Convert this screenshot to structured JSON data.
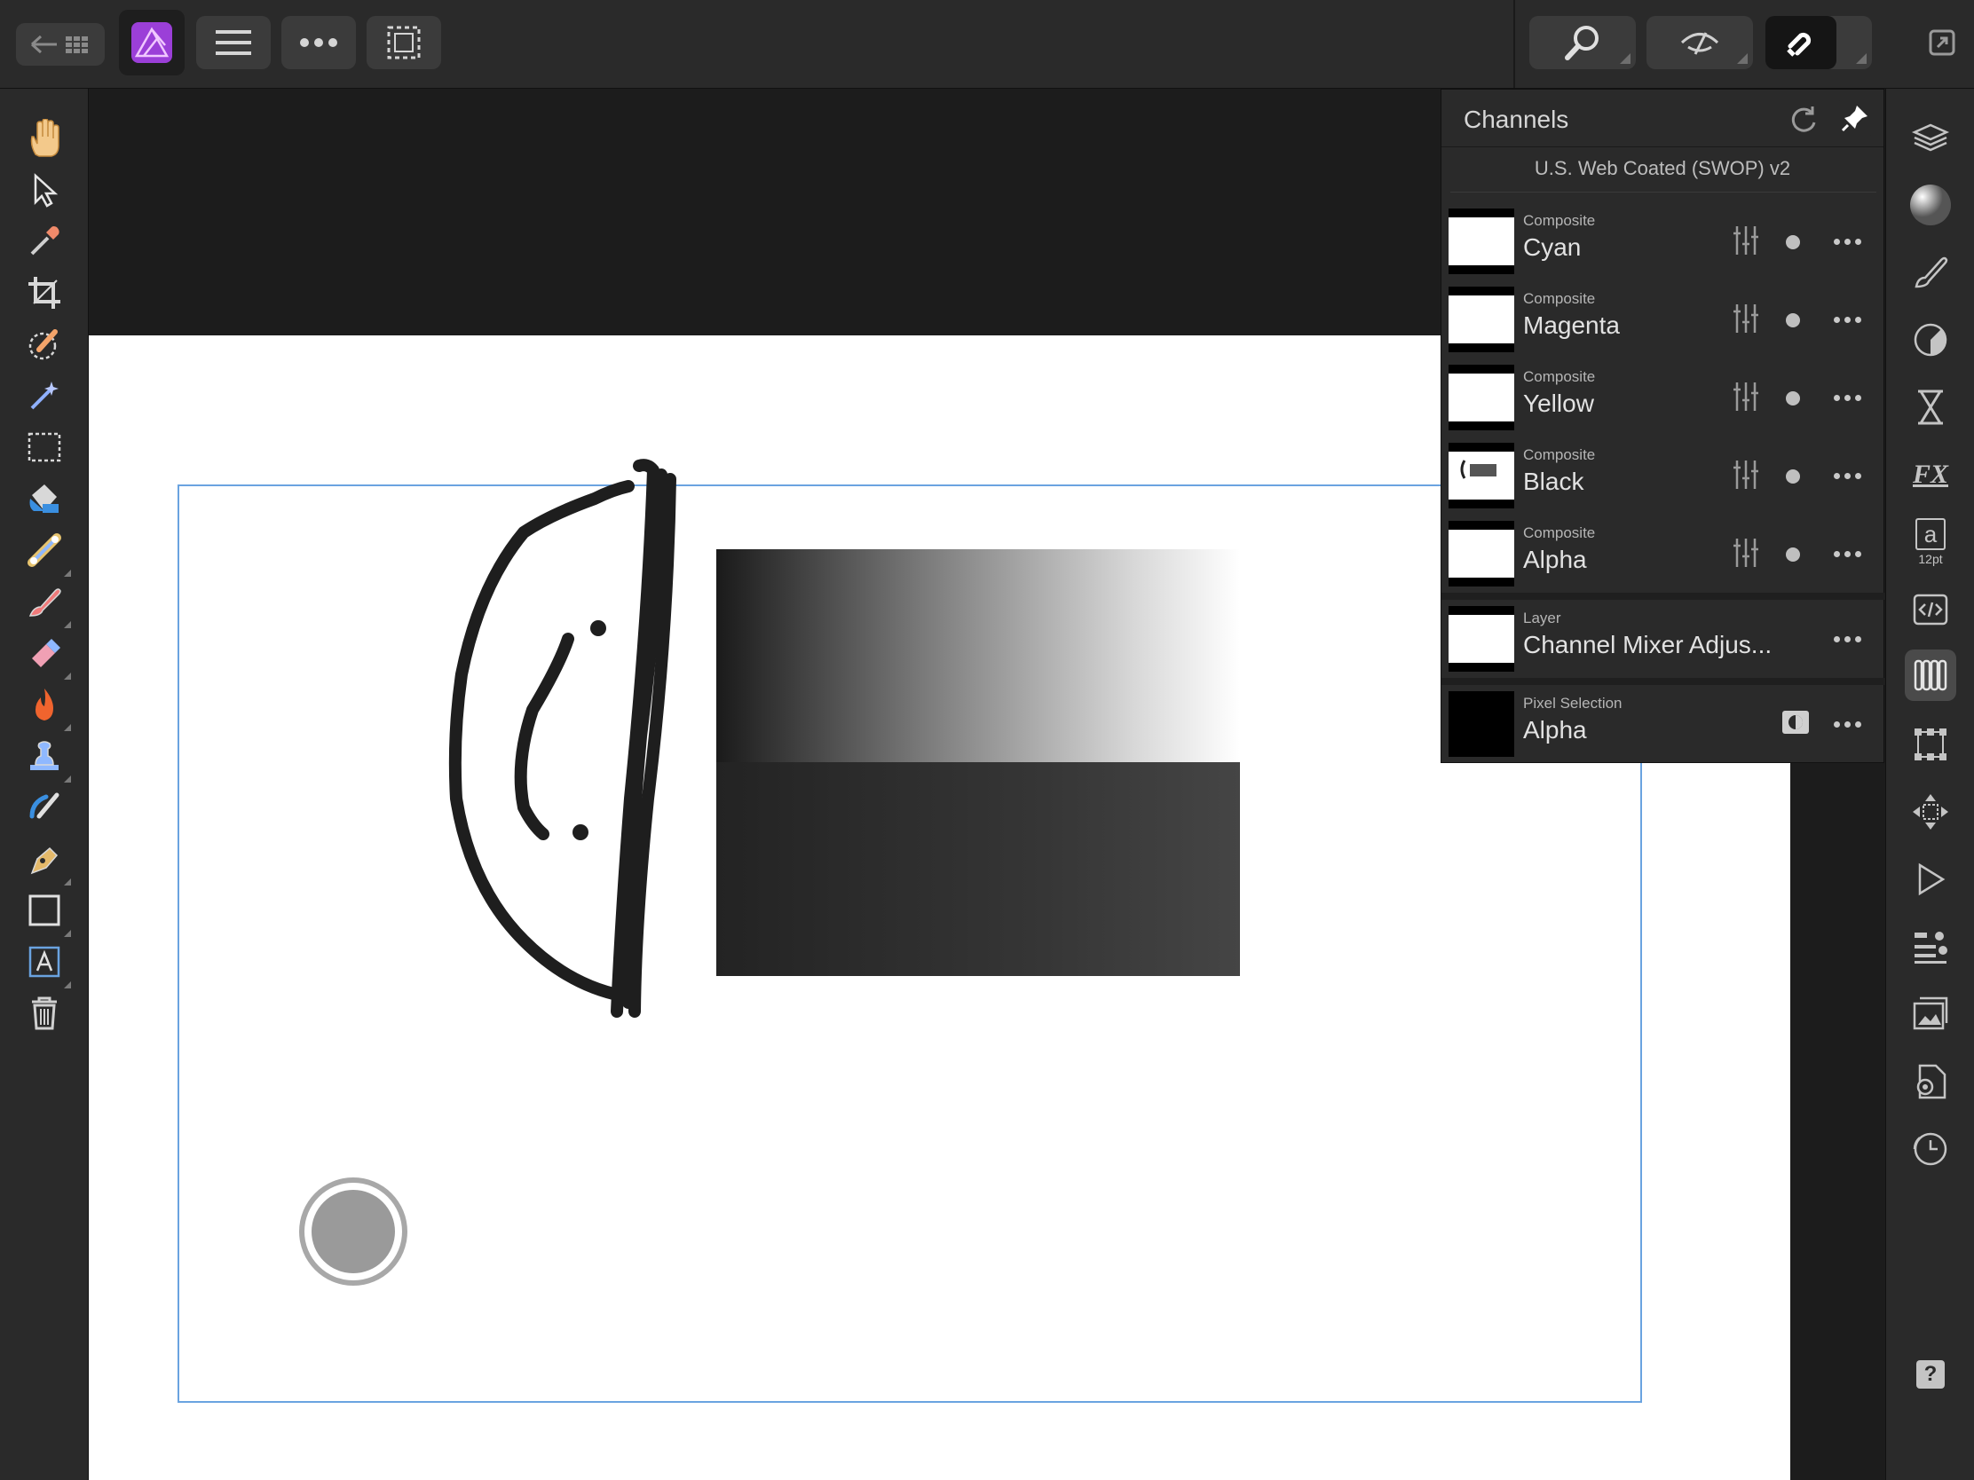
{
  "app": {
    "brand_color": "#9b3fd8",
    "selection_color": "#6aa3e0"
  },
  "topbar": {
    "left_buttons": [
      "back-to-gallery-icon",
      "app-logo-icon",
      "menu-icon",
      "more-icon",
      "selection-icon"
    ],
    "right_buttons": [
      "zoom-icon",
      "view-mode-icon",
      "snapping-icon",
      "fullscreen-icon"
    ]
  },
  "left_tools": [
    "hand-icon",
    "move-icon",
    "color-picker-icon",
    "crop-icon",
    "selection-brush-icon",
    "flood-select-icon",
    "marquee-icon",
    "fill-icon",
    "gradient-icon",
    "paint-brush-icon",
    "eraser-icon",
    "burn-icon",
    "clone-icon",
    "smudge-icon",
    "pen-icon",
    "rectangle-icon",
    "artistic-text-icon",
    "delete-icon"
  ],
  "studio_tools": [
    "layers-icon",
    "color-icon",
    "brushes-icon",
    "adjustments-icon",
    "transparency-icon",
    "fx-icon",
    "character-icon",
    "macro-icon",
    "channels-icon",
    "transform-icon",
    "navigator-icon",
    "stock-icon",
    "styles-icon",
    "history-icon",
    "document-settings-icon",
    "time-icon",
    "help-icon"
  ],
  "studio_labels": {
    "character_size": "12pt",
    "character_glyph": "a",
    "fx_label": "FX",
    "help_label": "?"
  },
  "channels": {
    "title": "Channels",
    "profile": "U.S. Web Coated (SWOP) v2",
    "composite": [
      {
        "kind": "Composite",
        "name": "Cyan"
      },
      {
        "kind": "Composite",
        "name": "Magenta"
      },
      {
        "kind": "Composite",
        "name": "Yellow"
      },
      {
        "kind": "Composite",
        "name": "Black"
      },
      {
        "kind": "Composite",
        "name": "Alpha"
      }
    ],
    "layer": {
      "kind": "Layer",
      "name": "Channel Mixer Adjus..."
    },
    "selection": {
      "kind": "Pixel Selection",
      "name": "Alpha"
    }
  }
}
